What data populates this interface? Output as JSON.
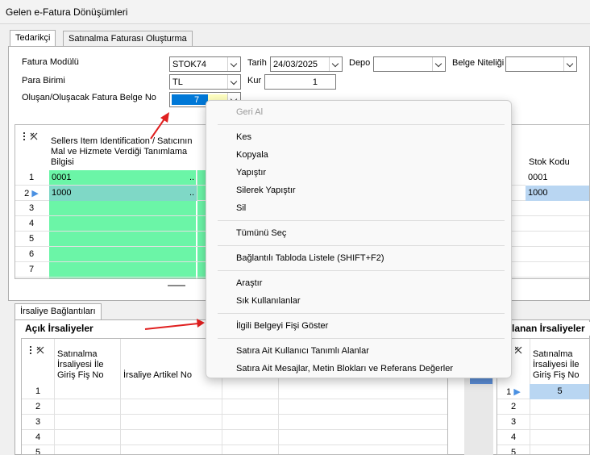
{
  "window": {
    "title": "Gelen e-Fatura Dönüşümleri"
  },
  "top_tabs": [
    {
      "label": "Tedarikçi"
    },
    {
      "label": "Satınalma Faturası Oluşturma"
    }
  ],
  "form": {
    "fatura_modulu_label": "Fatura Modülü",
    "fatura_modulu_value": "STOK74",
    "tarih_label": "Tarih",
    "tarih_value": "24/03/2025",
    "depo_label": "Depo",
    "depo_value": "",
    "belge_niteligi_label": "Belge Niteliği",
    "belge_niteligi_value": "",
    "para_birimi_label": "Para Birimi",
    "para_birimi_value": "TL",
    "kur_label": "Kur",
    "kur_value": "1",
    "belge_no_label": "Oluşan/Oluşacak Fatura Belge No",
    "belge_no_value": "7"
  },
  "main_grid": {
    "col1_header": "Sellers Item Identification / Satıcının Mal ve Hizmete Verdiği Tanımlama Bilgisi",
    "right_header": "Stok Kodu",
    "row_numbers": [
      "1",
      "2",
      "3",
      "4",
      "5",
      "6",
      "7"
    ],
    "col1_values": [
      "0001",
      "1000",
      "",
      "",
      "",
      "",
      ""
    ],
    "right_values": [
      "0001",
      "1000",
      "",
      "",
      "",
      "",
      ""
    ],
    "ellipsis": ".."
  },
  "bottom_tab": {
    "label": "İrsaliye Bağlantıları"
  },
  "acik_irsaliyeler": {
    "title": "Açık İrsaliyeler",
    "col1_header": "Satınalma İrsaliyesi İle Giriş Fiş No",
    "col2_header": "İrsaliye Artikel No",
    "row_numbers": [
      "1",
      "2",
      "3",
      "4",
      "5"
    ]
  },
  "baglanan_irsaliyeler": {
    "title": "ağlanan İrsaliyeler",
    "col1_header": "Satınalma İrsaliyesi İle Giriş Fiş No",
    "row_numbers": [
      "1",
      "2",
      "3",
      "4",
      "5"
    ],
    "col1_values": [
      "5",
      "",
      "",
      "",
      ""
    ]
  },
  "context_menu": {
    "items": [
      {
        "label": "Geri Al",
        "disabled": true
      },
      {
        "label": "Kes"
      },
      {
        "label": "Kopyala"
      },
      {
        "label": "Yapıştır"
      },
      {
        "label": "Silerek Yapıştır"
      },
      {
        "label": "Sil"
      },
      {
        "label": "Tümünü Seç"
      },
      {
        "label": "Bağlantılı Tabloda Listele (SHIFT+F2)"
      },
      {
        "label": "Araştır"
      },
      {
        "label": "Sık Kullanılanlar"
      },
      {
        "label": "İlgili Belgeyi Fişi Göster"
      },
      {
        "label": "Satıra Ait Kullanıcı Tanımlı Alanlar"
      },
      {
        "label": "Satıra Ait Mesajlar, Metin Blokları ve Referans Değerler"
      }
    ]
  },
  "colors": {
    "green": "#6bf5a7",
    "selection": "#0078d7",
    "row_highlight": "#b9d6f2",
    "arrow": "#e02020"
  }
}
